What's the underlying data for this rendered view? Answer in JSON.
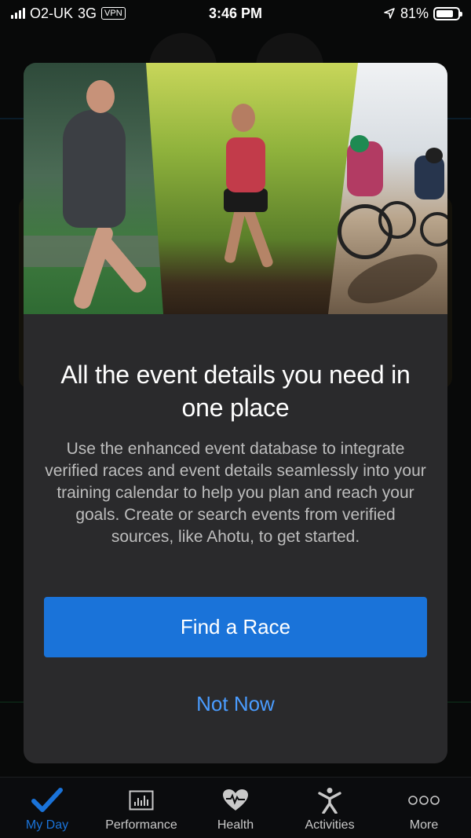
{
  "status_bar": {
    "carrier": "O2-UK",
    "network": "3G",
    "vpn": "VPN",
    "time": "3:46 PM",
    "battery": "81%",
    "battery_level": 0.81
  },
  "modal": {
    "title": "All the event details you need in one place",
    "description": "Use the enhanced event database to integrate verified races and event details seamlessly into your training calendar to help you plan and reach your goals. Create or search events from verified sources, like Ahotu, to get started.",
    "primary_button": "Find a Race",
    "secondary_button": "Not Now",
    "hero_panels": [
      "runner-woman",
      "trail-runner",
      "cyclists"
    ]
  },
  "tab_bar": {
    "items": [
      {
        "label": "My Day",
        "icon": "checkmark-icon",
        "active": true
      },
      {
        "label": "Performance",
        "icon": "chart-icon",
        "active": false
      },
      {
        "label": "Health",
        "icon": "heart-pulse-icon",
        "active": false
      },
      {
        "label": "Activities",
        "icon": "person-activity-icon",
        "active": false
      },
      {
        "label": "More",
        "icon": "more-dots-icon",
        "active": false
      }
    ]
  },
  "colors": {
    "accent": "#1a73d9",
    "link": "#4a9cff",
    "modal_bg": "#2a2a2c"
  }
}
